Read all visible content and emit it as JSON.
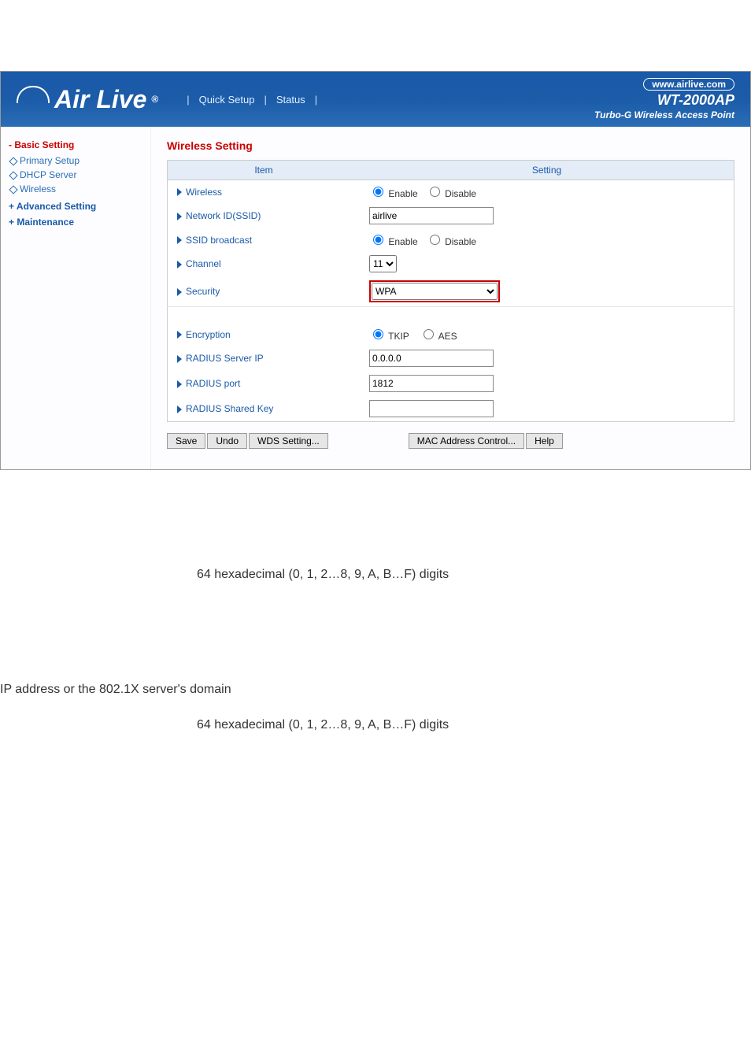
{
  "header": {
    "logo_text": "Air Live",
    "logo_reg": "®",
    "nav": {
      "quick_setup": "Quick Setup",
      "status": "Status"
    },
    "url_pill": "www.airlive.com",
    "product": "WT-2000AP",
    "tagline": "Turbo-G Wireless Access Point"
  },
  "sidebar": {
    "basic_setting": "- Basic Setting",
    "items": [
      {
        "label": "Primary Setup"
      },
      {
        "label": "DHCP Server"
      },
      {
        "label": "Wireless"
      }
    ],
    "advanced_setting": "+ Advanced Setting",
    "maintenance": "+ Maintenance"
  },
  "content": {
    "title": "Wireless Setting",
    "col_item": "Item",
    "col_setting": "Setting",
    "rows": {
      "wireless_label": "Wireless",
      "wireless_enable": "Enable",
      "wireless_disable": "Disable",
      "network_id_label": "Network ID(SSID)",
      "network_id_value": "airlive",
      "ssid_broadcast_label": "SSID broadcast",
      "ssid_enable": "Enable",
      "ssid_disable": "Disable",
      "channel_label": "Channel",
      "channel_value": "11",
      "security_label": "Security",
      "security_value": "WPA",
      "encryption_label": "Encryption",
      "encryption_tkip": "TKIP",
      "encryption_aes": "AES",
      "radius_ip_label": "RADIUS Server IP",
      "radius_ip_value": "0.0.0.0",
      "radius_port_label": "RADIUS port",
      "radius_port_value": "1812",
      "radius_key_label": "RADIUS Shared Key",
      "radius_key_value": ""
    },
    "buttons": {
      "save": "Save",
      "undo": "Undo",
      "wds": "WDS Setting...",
      "mac": "MAC Address Control...",
      "help": "Help"
    }
  },
  "below": {
    "line1": "64 hexadecimal (0, 1, 2…8, 9, A, B…F) digits",
    "line2": "IP address or the 802.1X server's domain",
    "line3": "64 hexadecimal (0, 1, 2…8, 9, A, B…F) digits"
  }
}
